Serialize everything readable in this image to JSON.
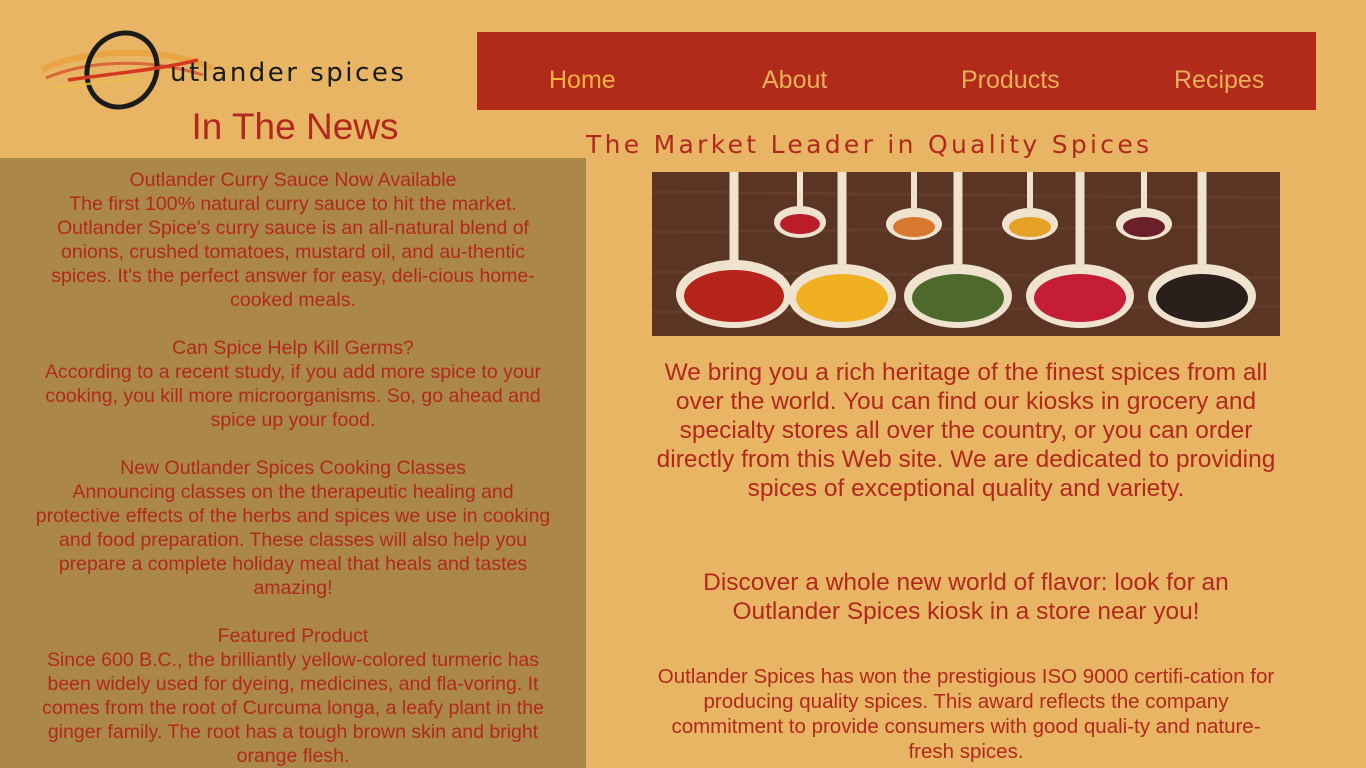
{
  "logo": {
    "text": "utlander spices",
    "icon": "swoosh-o-logo-icon"
  },
  "nav": {
    "items": [
      {
        "label": "Home",
        "active": true
      },
      {
        "label": "About",
        "active": false
      },
      {
        "label": "Products",
        "active": false
      },
      {
        "label": "Recipes",
        "active": false
      }
    ]
  },
  "news": {
    "heading": "In The News",
    "items": [
      {
        "title": "Outlander Curry Sauce Now Available",
        "body": "The first 100% natural curry sauce to hit the market. Outlander Spice's curry sauce is an all-natural blend of onions, crushed tomatoes, mustard oil, and au-thentic spices. It's the perfect answer for easy, deli-cious home-cooked meals."
      },
      {
        "title": "Can Spice Help Kill Germs?",
        "body": "According to a recent study, if you add more spice to your cooking, you kill more microorganisms. So, go ahead and spice up your food."
      },
      {
        "title": "New Outlander Spices Cooking Classes",
        "body": "Announcing classes on the therapeutic healing and protective effects of the herbs and spices we use in cooking and food preparation. These classes will also help you prepare a complete holiday meal that heals and tastes amazing!"
      },
      {
        "title": "Featured Product",
        "body": "Since 600 B.C., the brilliantly yellow-colored turmeric has been widely used for dyeing, medicines, and fla-voring. It comes from the root of Curcuma longa, a leafy plant in the ginger family. The root has a tough brown skin and bright orange flesh."
      }
    ]
  },
  "main": {
    "tagline": "The Market Leader in Quality Spices",
    "intro": "We bring you a rich heritage of the finest spices from all over the world. You can find our kiosks in grocery and specialty stores all over the country, or you can order directly from this Web site. We are dedicated to providing spices of exceptional quality and variety.",
    "discover": "Discover a whole new world of flavor: look for an Outlander Spices kiosk in a store near you!",
    "iso": "Outlander Spices has won the prestigious ISO 9000 certifi-cation for producing quality spices. This award reflects the company commitment to provide consumers with good quali-ty and nature-fresh spices."
  },
  "colors": {
    "background": "#e7b563",
    "nav_bg": "#b22a1a",
    "nav_text": "#e9b05a",
    "text": "#b2281e",
    "news_panel": "#ab8849"
  },
  "hero": {
    "icon": "spice-spoons-photo"
  }
}
